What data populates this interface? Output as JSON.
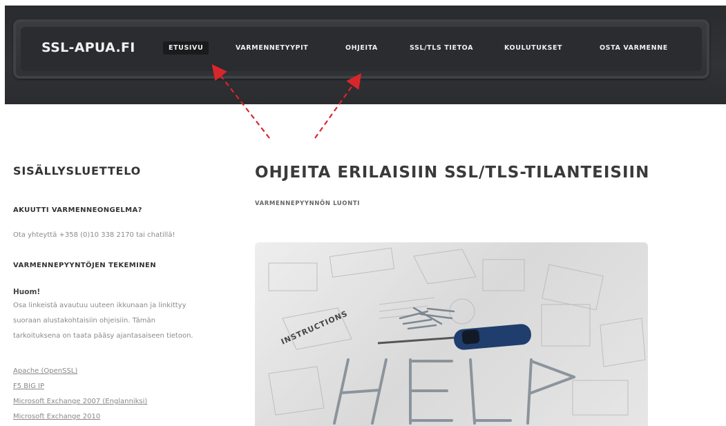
{
  "header": {
    "brand": "SSL-APUA.FI",
    "nav": [
      {
        "label": "ETUSIVU",
        "active": true
      },
      {
        "label": "VARMENNETYYPIT",
        "active": false
      },
      {
        "label": "OHJEITA",
        "active": false
      },
      {
        "label": "SSL/TLS TIETOA",
        "active": false
      },
      {
        "label": "KOULUTUKSET",
        "active": false
      },
      {
        "label": "OSTA VARMENNE",
        "active": false
      }
    ]
  },
  "sidebar": {
    "title": "SISÄLLYSLUETTELO",
    "urgent_heading": "AKUUTTI VARMENNEONGELMA?",
    "urgent_text": "Ota yhteyttä +358 (0)10 338 2170 tai chatillä!",
    "requests_heading": "VARMENNEPYYNTÖJEN TEKEMINEN",
    "note_title": "Huom!",
    "note_lines": [
      "Osa linkeistä avautuu uuteen ikkunaan ja linkittyy",
      "suoraan alustakohtaisiin ohjeisiin. Tämän",
      "tarkoituksena on taata pääsy ajantasaiseen tietoon."
    ],
    "links": [
      "Apache (OpenSSL)",
      "F5 BIG IP",
      "Microsoft Exchange 2007 (Englanniksi)",
      "Microsoft Exchange 2010"
    ]
  },
  "main": {
    "title": "OHJEITA ERILAISIIN SSL/TLS-TILANTEISIIN",
    "subtitle": "VARMENNEPYYNNÖN LUONTI",
    "hero_word": "INSTRUCTIONS"
  },
  "colors": {
    "header_bg": "#2d2e31",
    "arrow": "#d9262b",
    "link": "#888888"
  }
}
